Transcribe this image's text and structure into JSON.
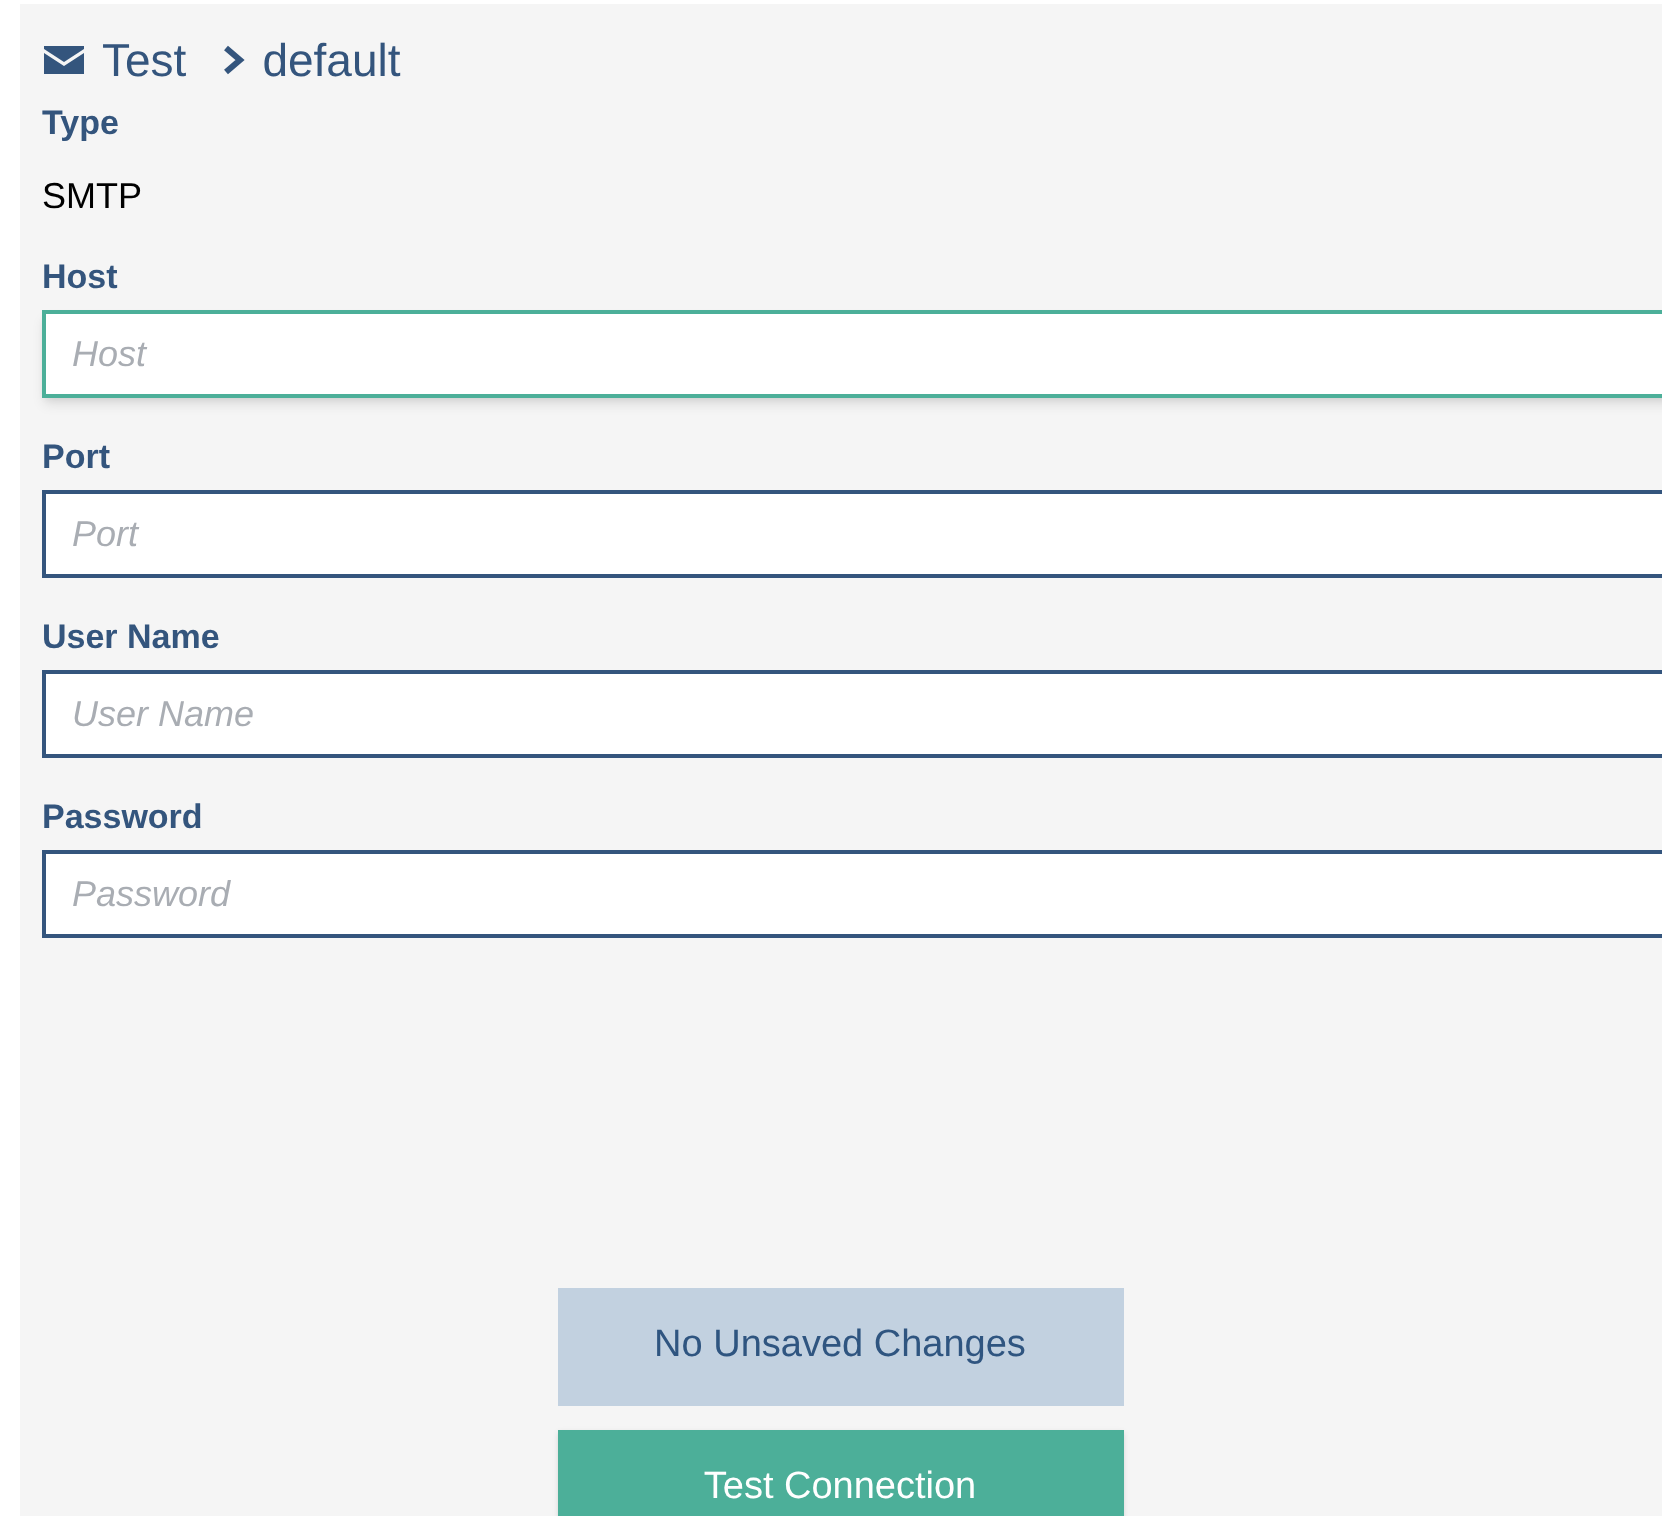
{
  "breadcrumb": {
    "parent": "Test",
    "current": "default"
  },
  "type": {
    "label": "Type",
    "value": "SMTP"
  },
  "fields": [
    {
      "label": "Host",
      "placeholder": "Host",
      "focused": true
    },
    {
      "label": "Port",
      "placeholder": "Port",
      "focused": false
    },
    {
      "label": "User Name",
      "placeholder": "User Name",
      "focused": false
    },
    {
      "label": "Password",
      "placeholder": "Password",
      "focused": false
    }
  ],
  "buttons": [
    {
      "label": "No Unsaved Changes",
      "kind": "status"
    },
    {
      "label": "Test Connection",
      "kind": "primary"
    }
  ]
}
